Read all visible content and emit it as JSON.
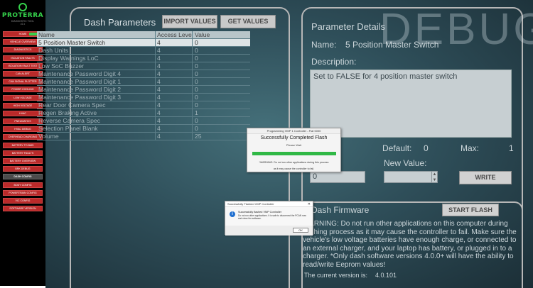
{
  "app": {
    "brand": "PROTERRA",
    "brand_sub": "DIAGNOSTIC TOOL",
    "brand_version": "v2.x"
  },
  "sidebar": {
    "items": [
      {
        "label": "HOME",
        "badge": true
      },
      {
        "label": "VEHICLE OVERVIEW"
      },
      {
        "label": "DIAGNOSTICS"
      },
      {
        "label": "ISOLATION FAULTS"
      },
      {
        "label": "ISOLATION FAULT TEST"
      },
      {
        "label": "CAN ALERT"
      },
      {
        "label": "CAN SIGNAL PLOTTER"
      },
      {
        "label": "POWER COOLING"
      },
      {
        "label": "LOW VOLTAGE"
      },
      {
        "label": "HIGH VOLTAGE"
      },
      {
        "label": "HVAC"
      },
      {
        "label": "PNEUMATICS"
      },
      {
        "label": "HVAC DEBUG"
      },
      {
        "label": "OVERHEAD CHARGING"
      },
      {
        "label": "BATTERY TO BMS"
      },
      {
        "label": "BATTERY FAULTS"
      },
      {
        "label": "BATTERY OVERVIEW"
      },
      {
        "label": "BRK DEBUG"
      },
      {
        "label": "DASH CONFIG",
        "active": true
      },
      {
        "label": "BODY CONFIG"
      },
      {
        "label": "POWERTRAIN CONFIG"
      },
      {
        "label": "VIC CONFIG"
      },
      {
        "label": "SOFTWARE VERSION"
      }
    ]
  },
  "left_panel": {
    "title": "Dash Parameters",
    "import_label": "IMPORT VALUES",
    "get_label": "GET VALUES",
    "columns": [
      "Name",
      "Access Level",
      "Value"
    ],
    "rows": [
      {
        "name": "5 Position Master Switch",
        "level": "4",
        "value": "0",
        "selected": true
      },
      {
        "name": "Dash Units",
        "level": "4",
        "value": "0"
      },
      {
        "name": "Display Warnings LoC",
        "level": "4",
        "value": "0"
      },
      {
        "name": "Low SoC Buzzer",
        "level": "4",
        "value": "0"
      },
      {
        "name": "Maintenance Password Digit 4",
        "level": "4",
        "value": "0"
      },
      {
        "name": "Maintenance Password Digit 1",
        "level": "4",
        "value": "0"
      },
      {
        "name": "Maintenance Password Digit 2",
        "level": "4",
        "value": "0"
      },
      {
        "name": "Maintenance Password Digit 3",
        "level": "4",
        "value": "0"
      },
      {
        "name": "Rear Door Camera Spec",
        "level": "4",
        "value": "0"
      },
      {
        "name": "Regen Braking Active",
        "level": "4",
        "value": "1"
      },
      {
        "name": "Reverse Camera Spec",
        "level": "4",
        "value": "0"
      },
      {
        "name": "Selection Panel Blank",
        "level": "4",
        "value": "0"
      },
      {
        "name": "Volume",
        "level": "4",
        "value": "25"
      }
    ]
  },
  "right_panel": {
    "title": "Parameter Details",
    "watermark": "DEBUG",
    "name_label": "Name:",
    "name_value": "5 Position Master Switch",
    "description_label": "Description:",
    "description_value": "Set to FALSE for 4 position master switch",
    "default_label": "Default:",
    "default_value": "0",
    "max_label": "Max:",
    "max_value": "1",
    "new_value_label": "New Value:",
    "current_value": "0",
    "write_label": "WRITE"
  },
  "firmware": {
    "title": "Dash Firmware",
    "start_label": "START FLASH",
    "warning": "WARNING: Do not run other applications on this computer during flashing process as it may cause the controller to fail. Make sure the vehicle's low voltage batteries have enough charge, or connected to an external charger, and your laptop has battery, or plugged in to a charger. *Only dash software versions 4.0.0+ will have the ability to read/write Eeprom values!",
    "version_label": "The current version is:",
    "version_value": "4.0.101"
  },
  "flash_dialog": {
    "title": "Programming VMP 1 Controller - Flat 0000",
    "heading": "Successfully Completed Flash",
    "status": "Please Wait",
    "progress": 1.0,
    "warning_line1": "*WARNING: Do not run other applications during this process",
    "warning_line2": "as it may cause the controller to fail."
  },
  "info_dialog": {
    "title": "Successfully Flashed VMP Controller",
    "heading": "Successfully flashed VMP Controller",
    "body": "Do not run other applications. It is safe to disconnect the PCAN now and close the software.",
    "ok_label": "OK",
    "close_label": "✕"
  },
  "colors": {
    "nav_red": "#ba2a2a",
    "nav_active": "#4b4b4b",
    "brand_green": "#35d14b",
    "progress_green": "#2fb845"
  }
}
